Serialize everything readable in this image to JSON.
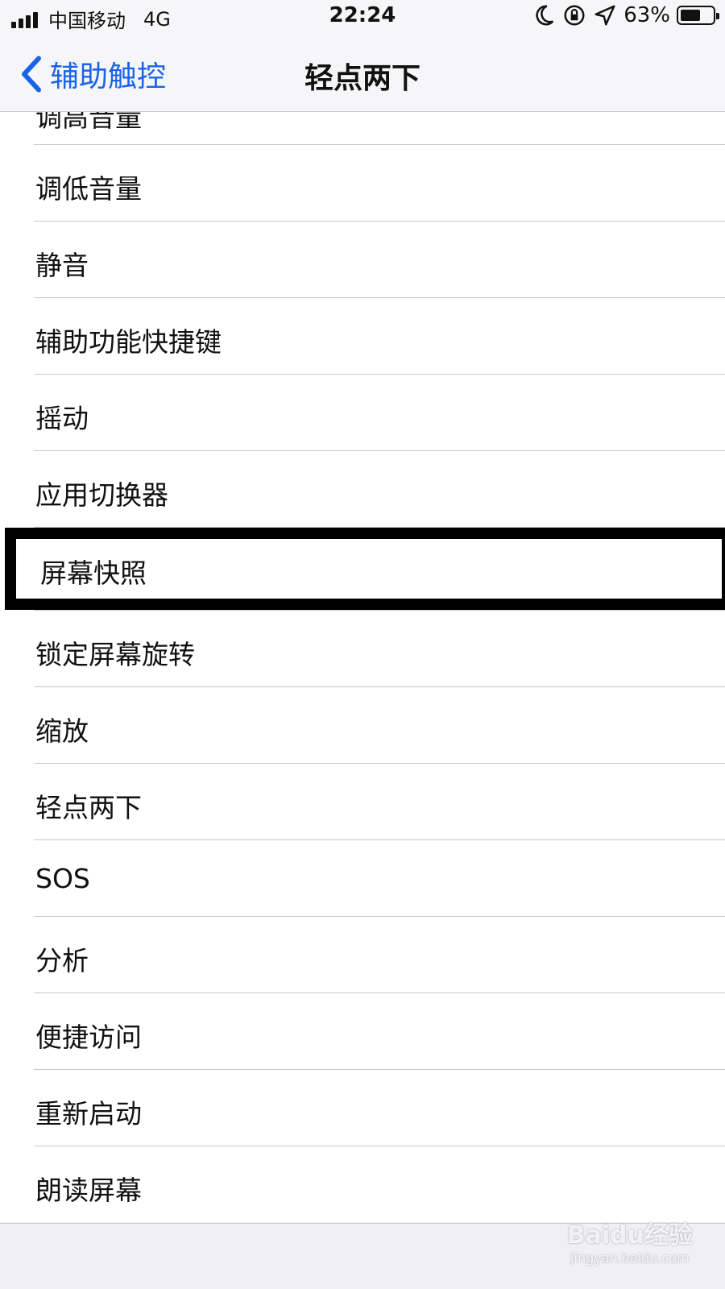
{
  "status_bar": {
    "carrier": "中国移动",
    "network": "4G",
    "time": "22:24",
    "battery_percent_label": "63%",
    "battery_level": 0.63,
    "icons": [
      "signal-icon",
      "moon-icon",
      "rotation-lock-icon",
      "location-icon",
      "battery-icon"
    ]
  },
  "nav": {
    "back_label": "辅助触控",
    "title": "轻点两下"
  },
  "list": {
    "partial_top_item": "调高音量",
    "items": [
      "调低音量",
      "静音",
      "辅助功能快捷键",
      "摇动",
      "应用切换器",
      "屏幕快照",
      "锁定屏幕旋转",
      "缩放",
      "轻点两下",
      "SOS",
      "分析",
      "便捷访问",
      "重新启动",
      "朗读屏幕"
    ],
    "highlighted_item": "屏幕快照"
  },
  "watermark": {
    "logo_text": "Baidu经验",
    "url": "jingyan.baidu.com"
  },
  "colors": {
    "accent": "#1a63e8",
    "highlight_border": "#000000"
  }
}
